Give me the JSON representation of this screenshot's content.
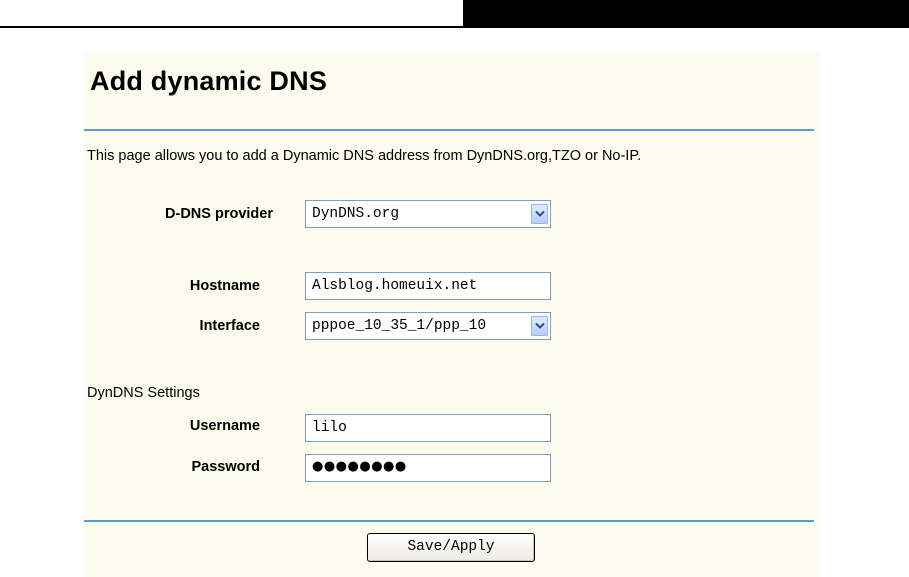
{
  "page": {
    "title": "Add dynamic DNS",
    "description": "This page allows you to add a Dynamic DNS address from DynDNS.org,TZO or No-IP."
  },
  "form": {
    "provider": {
      "label": "D-DNS provider",
      "value": "DynDNS.org"
    },
    "hostname": {
      "label": "Hostname",
      "value": "Alsblog.homeuix.net"
    },
    "interface": {
      "label": "Interface",
      "value": "pppoe_10_35_1/ppp_10"
    },
    "settings_section": "DynDNS Settings",
    "username": {
      "label": "Username",
      "value": "lilo"
    },
    "password": {
      "label": "Password",
      "masked": "●●●●●●●●"
    }
  },
  "actions": {
    "save_label": "Save/Apply"
  },
  "colors": {
    "panel_bg": "#fbfbee",
    "rule": "#5a9bd0",
    "field_border": "#7f9db9"
  },
  "icons": {
    "dropdown": "chevron-down-icon"
  }
}
